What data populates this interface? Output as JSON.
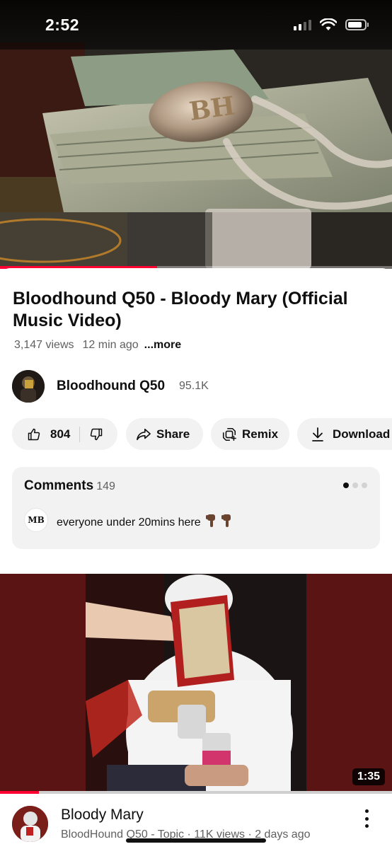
{
  "status_bar": {
    "time": "2:52",
    "icons": [
      "cellular-signal-icon",
      "wifi-icon",
      "battery-icon"
    ]
  },
  "player": {
    "progress_fraction": 0.4,
    "accent": "#ff0033"
  },
  "video": {
    "title": "Bloodhound Q50 - Bloody Mary (Official Music Video)",
    "views": "3,147 views",
    "age": "12 min ago",
    "more_label": "...more"
  },
  "channel": {
    "name": "Bloodhound Q50",
    "subscribers": "95.1K"
  },
  "actions": {
    "like_count": "804",
    "share_label": "Share",
    "remix_label": "Remix",
    "download_label": "Download",
    "icons": [
      "thumbs-up-icon",
      "thumbs-down-icon",
      "share-icon",
      "remix-icon",
      "download-icon"
    ]
  },
  "comments": {
    "header": "Comments",
    "count": "149",
    "top_comment": {
      "avatar_initials": "MB",
      "text": "everyone under 20mins here"
    }
  },
  "next_video": {
    "duration": "1:35",
    "progress_fraction": 0.1,
    "title": "Bloody Mary",
    "meta": "BloodHound Q50 - Topic · 11K views · 2 days ago"
  }
}
